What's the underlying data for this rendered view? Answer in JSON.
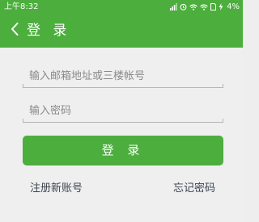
{
  "status_bar": {
    "time": "上午8:32",
    "battery": "4%",
    "icons": [
      "signal-icon",
      "alarm-icon",
      "wifi-icon",
      "wifi-icon",
      "sim-icon",
      "battery-charging-icon"
    ]
  },
  "header": {
    "back_icon": "chevron-left-icon",
    "title": "登 录"
  },
  "form": {
    "account_placeholder": "输入邮箱地址或三楼帐号",
    "account_value": "",
    "password_placeholder": "输入密码",
    "password_value": ""
  },
  "login_button_label": "登 录",
  "links": {
    "register": "注册新账号",
    "forgot_password": "忘记密码"
  },
  "colors": {
    "accent": "#4cae3d",
    "background": "#efefef",
    "link_text": "#3b4350"
  }
}
